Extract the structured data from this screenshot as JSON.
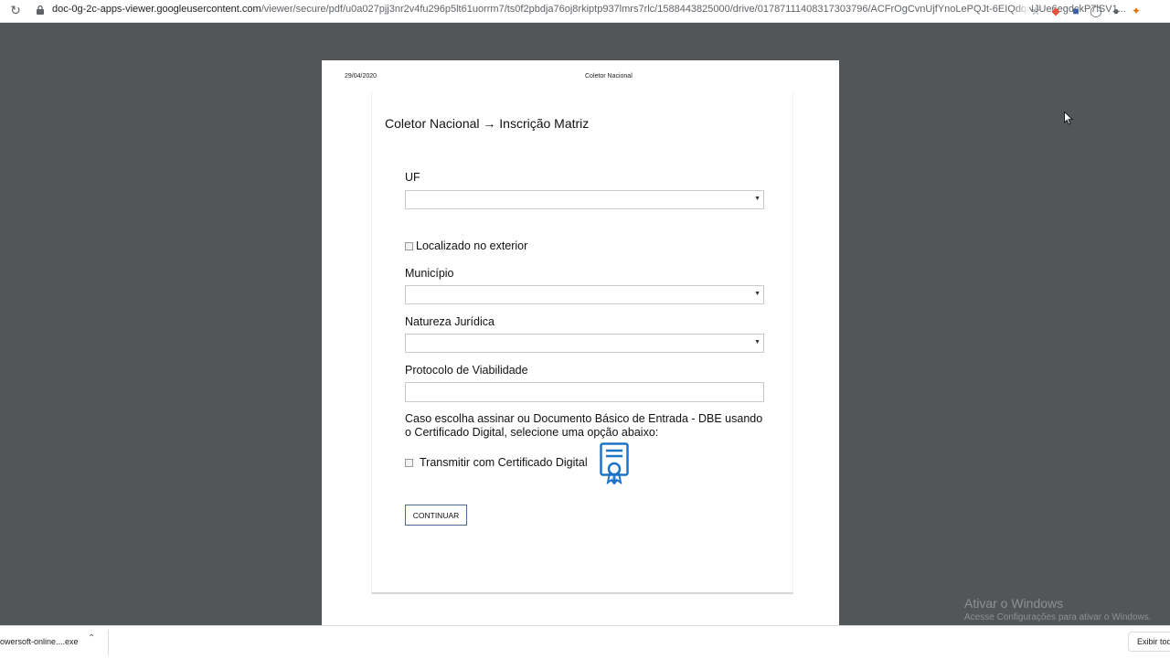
{
  "browser": {
    "url_host": "doc-0g-2c-apps-viewer.googleusercontent.com",
    "url_path": "/viewer/secure/pdf/u0a027pjj3nr2v4fu296p5lt61uorrm7/ts0f2pbdja76oj8rkiptp937lmrs7rlc/1588443825000/drive/01787111408317303796/ACFrOgCvnUjfYnoLePQJt-6EIQdqNJUe6egdckP7lSV1...",
    "icons": [
      "reload-icon",
      "lock-icon",
      "star-icon",
      "extension-icon",
      "extension-icon",
      "extension-icon",
      "extension-icon",
      "extension-icon"
    ]
  },
  "pdf": {
    "header_date": "29/04/2020",
    "header_title": "Coletor Nacional"
  },
  "form": {
    "title": "Coletor Nacional → Inscrição Matriz",
    "uf_label": "UF",
    "uf_value": "",
    "exterior_label": "Localizado no exterior",
    "exterior_checked": false,
    "municipio_label": "Município",
    "municipio_value": "",
    "natureza_label": "Natureza Jurídica",
    "natureza_value": "",
    "protocolo_label": "Protocolo de Viabilidade",
    "protocolo_value": "",
    "info_text": "Caso escolha assinar ou Documento Básico de Entrada - DBE usando o Certificado Digital, selecione uma opção abaixo:",
    "certificado_label": "Transmitir com Certificado Digital",
    "certificado_checked": false,
    "continue_label": "CONTINUAR"
  },
  "watermark": {
    "title": "Ativar o Windows",
    "subtitle": "Acesse Configurações para ativar o Windows."
  },
  "downloads": {
    "item_name": "owersoft-online....exe",
    "show_all_label": "Exibir tod"
  },
  "colors": {
    "viewer_bg": "#525659",
    "button_border": "#4a6a9a",
    "cert_icon": "#1e73c8"
  }
}
